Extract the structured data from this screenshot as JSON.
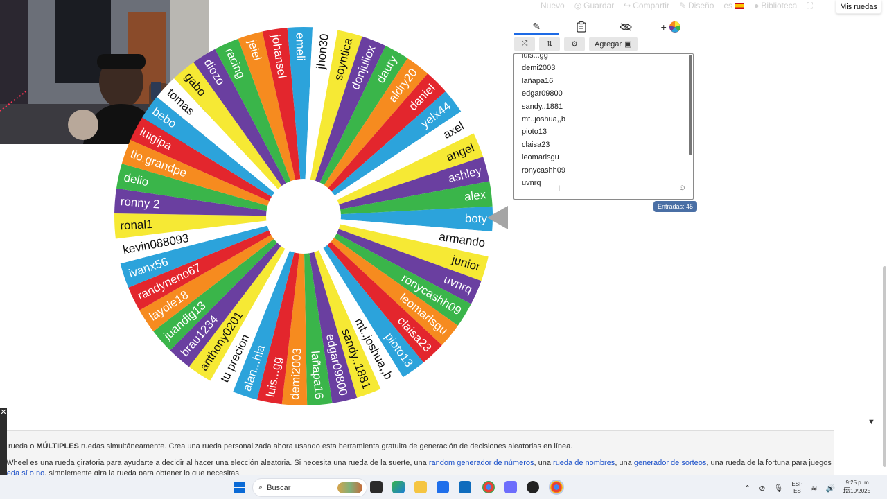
{
  "topnav": {
    "nuevo": "Nuevo",
    "guardar": "Guardar",
    "compartir": "Compartir",
    "diseno": "Diseño",
    "language": "es",
    "biblioteca": "Biblioteca",
    "mis_ruedas": "Mis ruedas"
  },
  "editor": {
    "tabs": [
      {
        "icon": "pencil-icon",
        "glyph": "✎",
        "active": true
      },
      {
        "icon": "clipboard-icon",
        "glyph": "📋",
        "active": false
      },
      {
        "icon": "eye-off-icon",
        "glyph": "◌",
        "active": false
      },
      {
        "icon": "add-wheel-icon",
        "glyph": "+",
        "active": false
      }
    ],
    "toolbar": {
      "shuffle_glyph": "⤮",
      "sort_glyph": "⇅",
      "settings_glyph": "⚙",
      "add_label": "Agregar"
    },
    "entries": [
      "luis...gg",
      "demi2003",
      "lañapa16",
      "edgar09800",
      "sandy..1881",
      "mt..joshua,,b",
      "pioto13",
      "claisa23",
      "leomarisgu",
      "ronycashh09",
      "uvnrq"
    ],
    "count_label": "Entradas: 45"
  },
  "wheel": {
    "colors": [
      "#2ca3db",
      "#ffffff",
      "#f6e934",
      "#6a3fa0",
      "#3ab54a",
      "#f68b1f",
      "#e3262d"
    ],
    "labels": [
      "boty",
      "armando",
      "junior",
      "uvnrq",
      "ronycashh09",
      "leomarisgu",
      "claisa23",
      "pioto13",
      "mt..joshua,,b",
      "sandy..1881",
      "edgar09800",
      "lañapa16",
      "demi2003",
      "luis...gg",
      "alan...hia",
      "tu precion",
      "anthony0201",
      "brau1234",
      "juandig13",
      "layole18",
      "randyneno67",
      "ivanx56",
      "kevin088093",
      "ronal1",
      "ronny 2",
      "delio",
      "tio.grandpe",
      "luigipa",
      "bebo",
      "tomas",
      "gabo",
      "diozo",
      "racing",
      "jeiel",
      "johansel",
      "emeli",
      "jhon30",
      "soyntica",
      "donjuliox",
      "daury",
      "aldry20",
      "daniel",
      "yelx44",
      "axel",
      "angel",
      "ashley",
      "alex"
    ]
  },
  "description": {
    "line1_pre": "rueda o ",
    "line1_bold": "MÚLTIPLES",
    "line1_post": " ruedas simultáneamente. Crea una rueda personalizada ahora usando esta herramienta gratuita de generación de decisiones aleatorias en línea.",
    "line2_pre": "e Wheel es una rueda giratoria para ayudarte a decidir al hacer una elección aleatoria. Si necesita una rueda de la suerte, una ",
    "link1": "random generador de números",
    "line2_mid1": ", una ",
    "link2": "rueda de nombres",
    "line2_mid2": ", una ",
    "link3": "generador de sorteos",
    "line2_post": ", una rueda de la fortuna para juegos o una",
    "link4": "rueda sí o no",
    "line3_post": ", simplemente gira la rueda para obtener lo que necesitas."
  },
  "taskbar": {
    "search_placeholder": "Buscar",
    "lang_top": "ESP",
    "lang_bottom": "ES",
    "time": "9:25 p. m.",
    "date": "12/10/2025"
  }
}
